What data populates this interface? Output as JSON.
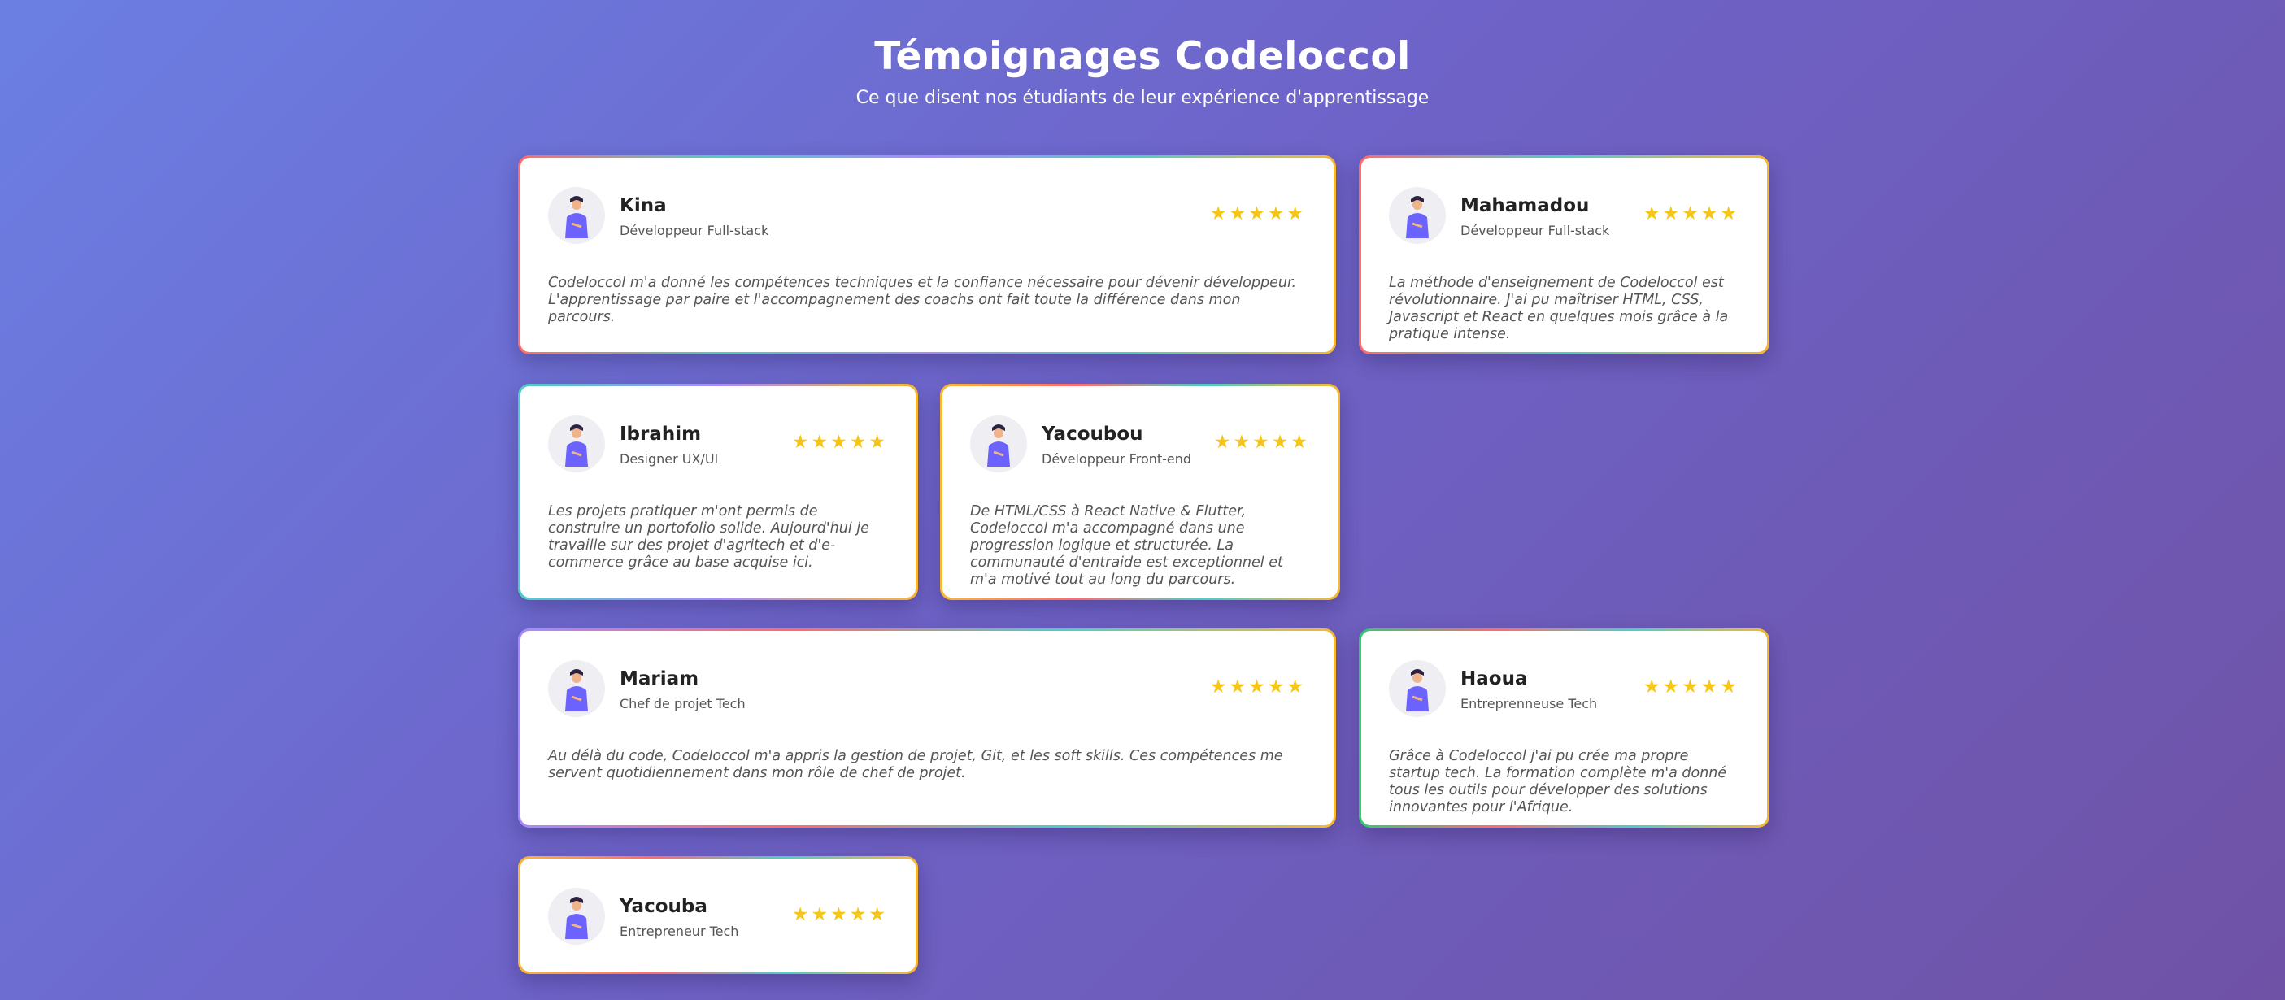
{
  "header": {
    "title": "Témoignages Codeloccol",
    "subtitle": "Ce que disent nos étudiants de leur expérience d'apprentissage"
  },
  "accent_colors": {
    "star": "#f5c518",
    "avatar_person": "#6c63ff",
    "border_red": "#ff6b6b",
    "border_teal": "#4ecdc4",
    "border_purple": "#a78bfa",
    "border_yellow": "#f7b731",
    "border_green": "#2ecc71"
  },
  "testimonials": [
    {
      "name": "Kina",
      "role": "Développeur Full-stack",
      "rating": 5,
      "stars": "★★★★★",
      "text": "Codeloccol m'a donné les compétences techniques et la confiance nécessaire pour dévenir développeur. L'apprentissage par paire et l'accompagnement des coachs ont fait toute la différence dans mon parcours."
    },
    {
      "name": "Mahamadou",
      "role": "Développeur Full-stack",
      "rating": 5,
      "stars": "★★★★★",
      "text": "La méthode d'enseignement de Codeloccol est révolutionnaire. J'ai pu maîtriser HTML, CSS, Javascript et React en quelques mois grâce à la pratique intense."
    },
    {
      "name": "Ibrahim",
      "role": "Designer UX/UI",
      "rating": 5,
      "stars": "★★★★★",
      "text": "Les projets pratiquer m'ont permis de construire un portofolio solide. Aujourd'hui je travaille sur des projet d'agritech et d'e-commerce grâce au base acquise ici."
    },
    {
      "name": "Yacoubou",
      "role": "Développeur Front-end",
      "rating": 5,
      "stars": "★★★★★",
      "text": "De HTML/CSS à React Native & Flutter, Codeloccol m'a accompagné dans une progression logique et structurée. La communauté d'entraide est exceptionnel et m'a motivé tout au long du parcours."
    },
    {
      "name": "Mariam",
      "role": "Chef de projet Tech",
      "rating": 5,
      "stars": "★★★★★",
      "text": "Au délà du code, Codeloccol m'a appris la gestion de projet, Git, et les soft skills. Ces compétences me servent quotidiennement dans mon rôle de chef de projet."
    },
    {
      "name": "Haoua",
      "role": "Entreprenneuse Tech",
      "rating": 5,
      "stars": "★★★★★",
      "text": "Grâce à Codeloccol j'ai pu crée ma propre startup tech. La formation complète m'a donné tous les outils pour développer des solutions innovantes pour l'Afrique."
    },
    {
      "name": "Yacouba",
      "role": "Entrepreneur Tech",
      "rating": 5,
      "stars": "★★★★★",
      "text": ""
    }
  ]
}
